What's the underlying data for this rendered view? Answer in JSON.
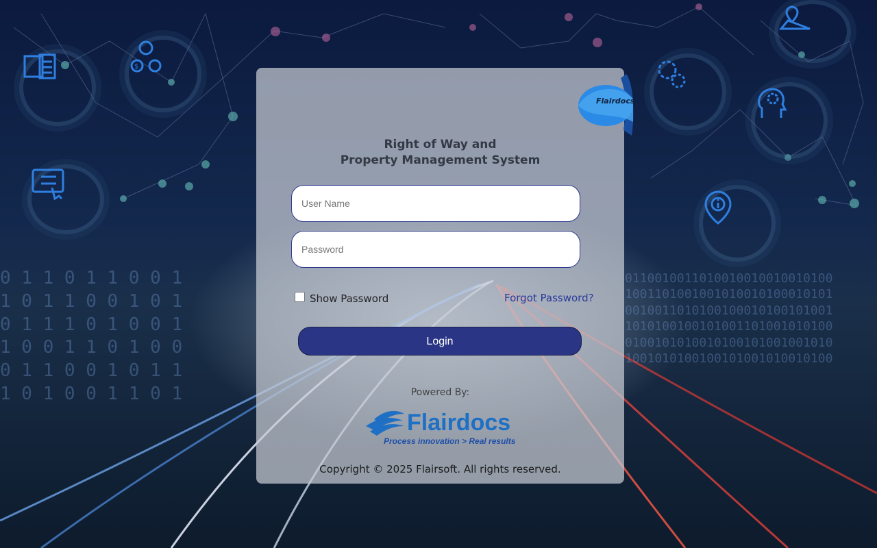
{
  "app": {
    "title_line1": "Right of Way and",
    "title_line2": "Property Management System"
  },
  "login_form": {
    "username_placeholder": "User Name",
    "username_value": "",
    "password_placeholder": "Password",
    "password_value": "",
    "show_password_label": "Show Password",
    "show_password_checked": false,
    "forgot_password_label": "Forgot Password?",
    "login_button_label": "Login"
  },
  "branding": {
    "ribbon_text": "Flairdocs",
    "powered_by_label": "Powered By:",
    "logo_wordmark": "Flairdocs",
    "logo_tagline": "Process innovation > Real results.",
    "copyright": "Copyright © 2025 Flairsoft. All rights reserved."
  },
  "background_icons": [
    "report-icon",
    "money-people-icon",
    "checklist-touch-icon",
    "map-pin-icon",
    "gear-binary-icon",
    "head-gear-icon",
    "info-location-icon"
  ],
  "colors": {
    "primary": "#2a3585",
    "link": "#2b3a9a",
    "logo_blue": "#1f6fc4",
    "tagline_blue": "#1f4fa8"
  }
}
